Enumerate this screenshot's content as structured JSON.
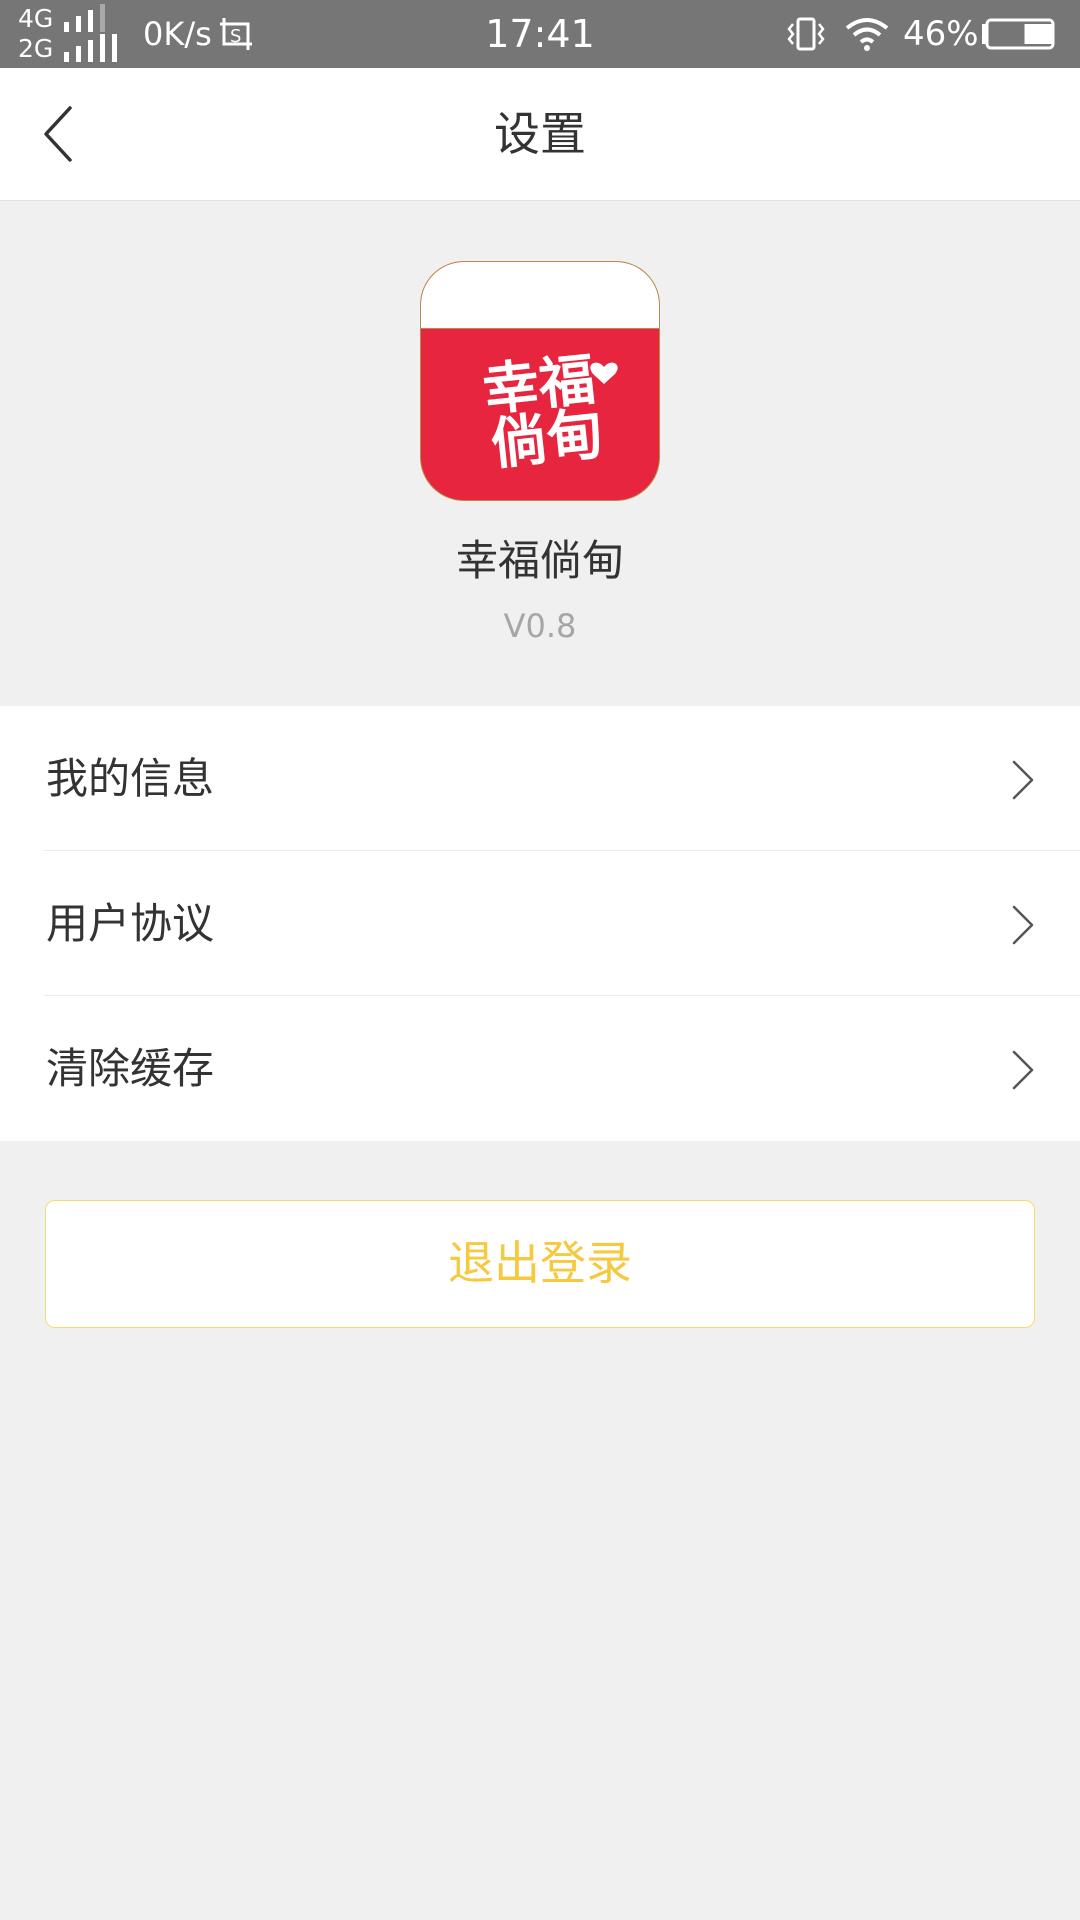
{
  "status_bar": {
    "net_top": "4G",
    "net_bottom": "2G",
    "speed": "0K/s",
    "time": "17:41",
    "battery_percent": "46%",
    "battery_level": 0.46,
    "icons": [
      "signal-icon",
      "screenshot-icon",
      "vibrate-icon",
      "wifi-icon",
      "battery-icon"
    ]
  },
  "nav": {
    "back_icon": "back-arrow-icon",
    "title": "设置"
  },
  "app": {
    "logo_text_line1": "幸福",
    "logo_text_line2": "倘甸",
    "name": "幸福倘甸",
    "version": "V0.8",
    "brand_color": "#e8253f"
  },
  "menu": {
    "items": [
      {
        "label": "我的信息",
        "icon": "chevron-right-icon"
      },
      {
        "label": "用户协议",
        "icon": "chevron-right-icon"
      },
      {
        "label": "清除缓存",
        "icon": "chevron-right-icon"
      }
    ]
  },
  "logout": {
    "label": "退出登录",
    "color": "#f5c940"
  }
}
